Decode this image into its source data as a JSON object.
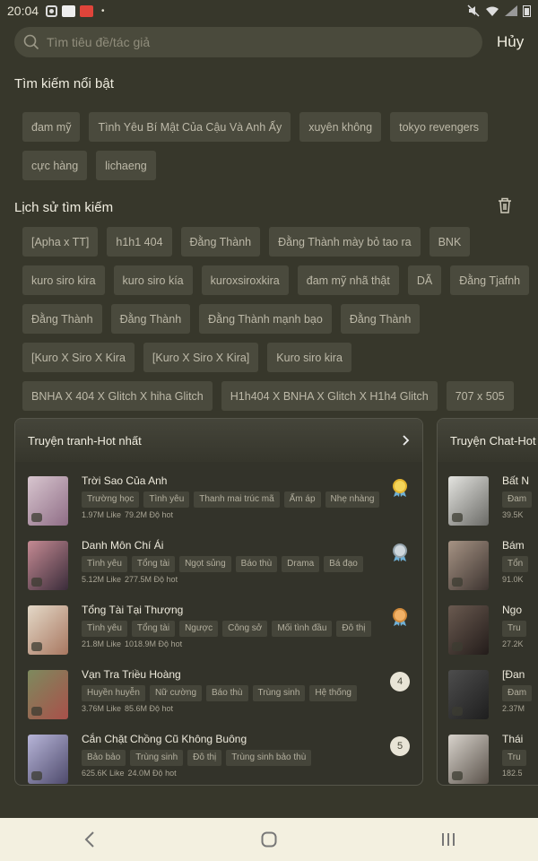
{
  "status": {
    "time": "20:04",
    "dot": "•"
  },
  "search": {
    "placeholder": "Tìm tiêu đề/tác giả",
    "value": "",
    "cancel_label": "Hủy"
  },
  "featured": {
    "title": "Tìm kiếm nổi bật",
    "items": [
      "đam mỹ",
      "Tình Yêu Bí Mật Của Cậu Và Anh Ấy",
      "xuyên không",
      "tokyo revengers",
      "cực hàng",
      "lichaeng"
    ]
  },
  "history": {
    "title": "Lịch sử tìm kiếm",
    "items": [
      "[Apha x TT]",
      "h1h1 404",
      "Đằng Thành",
      "Đằng Thành  mày bỏ tao ra",
      "BNK",
      "kuro siro kira",
      "kuro siro kía",
      "kuroxsiroxkira",
      "đam mỹ nhã thật",
      "DÃ",
      "Đằng Tjafnh",
      "Đằng Thành",
      "Đằng Thành",
      "Đằng Thành mạnh bạo",
      "Đằng Thành",
      "[Kuro X Siro X Kira",
      "[Kuro X Siro X Kira]",
      "Kuro siro kira",
      "BNHA X 404 X Glitch X hiha Glitch",
      "H1h404 X BNHA X Glitch X H1h4 Glitch",
      "707 x 505"
    ]
  },
  "hot_comics": {
    "title": "Truyện tranh-Hot nhất",
    "items": [
      {
        "title": "Trời Sao Của Anh",
        "tags": [
          "Trường học",
          "Tình yêu",
          "Thanh mai trúc mã",
          "Ấm áp",
          "Nhẹ nhàng"
        ],
        "likes": "1.97M Like",
        "hot": "79.2M Độ hot",
        "rank": "1",
        "medal": "gold",
        "cover": [
          "#d8c6cf",
          "#8f6d86"
        ]
      },
      {
        "title": "Danh Môn Chí Ái",
        "tags": [
          "Tình yêu",
          "Tổng tài",
          "Ngọt sủng",
          "Báo thù",
          "Drama",
          "Bá đạo"
        ],
        "likes": "5.12M Like",
        "hot": "277.5M Độ hot",
        "rank": "2",
        "medal": "silver",
        "cover": [
          "#c58a93",
          "#3a2c3a"
        ]
      },
      {
        "title": "Tổng Tài Tại Thượng",
        "tags": [
          "Tình yêu",
          "Tổng tài",
          "Ngược",
          "Công sở",
          "Mối tình đầu",
          "Đô thị"
        ],
        "likes": "21.8M Like",
        "hot": "1018.9M Độ hot",
        "rank": "3",
        "medal": "bronze",
        "cover": [
          "#e4d9c8",
          "#a87760"
        ]
      },
      {
        "title": "Vạn Tra Triều Hoàng",
        "tags": [
          "Huyền huyễn",
          "Nữ cường",
          "Báo thù",
          "Trùng sinh",
          "Hệ thống"
        ],
        "likes": "3.76M Like",
        "hot": "85.6M Độ hot",
        "rank": "4",
        "medal": "",
        "cover": [
          "#7d8a5e",
          "#a9504a"
        ]
      },
      {
        "title": "Cắn Chặt Chồng Cũ Không Buông",
        "tags": [
          "Bảo bảo",
          "Trùng sinh",
          "Đô thị",
          "Trùng sinh bảo thù"
        ],
        "likes": "625.6K Like",
        "hot": "24.0M Độ hot",
        "rank": "5",
        "medal": "",
        "cover": [
          "#b7b5d8",
          "#4e4a6c"
        ]
      }
    ]
  },
  "hot_chat": {
    "title": "Truyện Chat-Hot",
    "items": [
      {
        "title": "Bất N",
        "tag": "Đam",
        "stat": "39.5K",
        "cover": [
          "#e4e4e0",
          "#6a6a66"
        ]
      },
      {
        "title": "Bám",
        "tag": "Tổn",
        "stat": "91.0K",
        "cover": [
          "#a69384",
          "#3d3430"
        ]
      },
      {
        "title": "Ngo",
        "tag": "Tru",
        "stat": "27.2K",
        "cover": [
          "#6a5a50",
          "#231c1a"
        ]
      },
      {
        "title": "[Đan",
        "tag": "Đam",
        "stat": "2.37M",
        "cover": [
          "#4d4d4d",
          "#1e1e1e"
        ]
      },
      {
        "title": "Thái",
        "tag": "Tru",
        "stat": "182.5",
        "cover": [
          "#d8d3cc",
          "#5a524a"
        ]
      }
    ]
  },
  "colors": {
    "background": "#37372b",
    "chip": "#4a4a3d",
    "navbar": "#f3f0e0"
  }
}
